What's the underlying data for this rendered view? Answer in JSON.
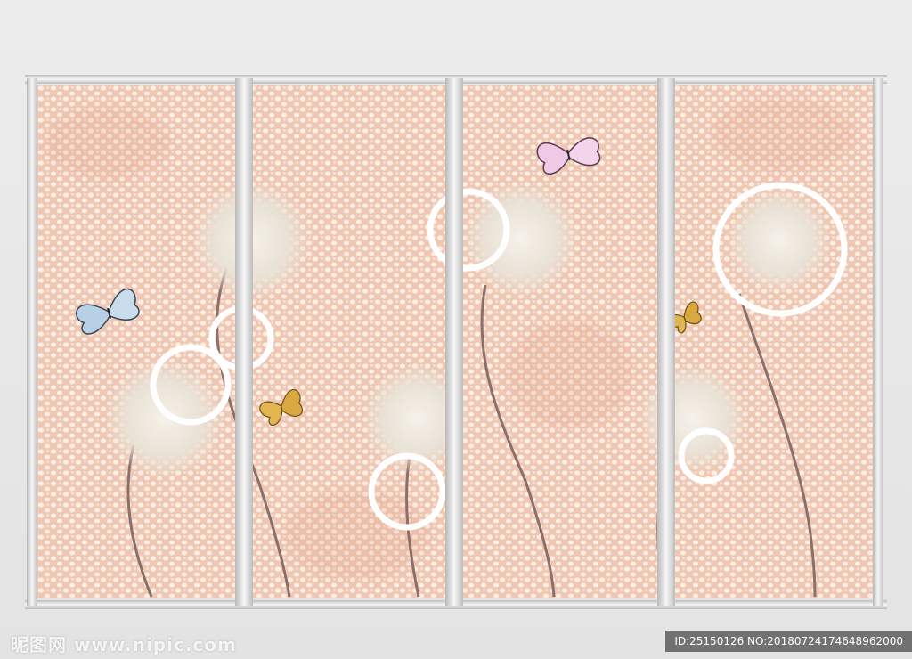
{
  "watermarks": {
    "site": "昵图网 www.nipic.com",
    "image_id": "ID:25150126 NO:20180724174648962000"
  },
  "colors": {
    "wall": "#e6e6e6",
    "panel_base": "#f0c9b6",
    "panel_dots": "#fbeee4",
    "frame": "#c8c8c8",
    "ring": "#ffffff",
    "stem": "#8a6f6a"
  },
  "panels": [
    {
      "name": "panel-1",
      "motifs": [
        "dandelion-icon",
        "dandelion-icon",
        "ring-icon",
        "ring-icon",
        "butterfly-icon"
      ]
    },
    {
      "name": "panel-2",
      "motifs": [
        "dandelion-icon",
        "ring-icon",
        "butterfly-icon"
      ]
    },
    {
      "name": "panel-3",
      "motifs": [
        "dandelion-icon",
        "ring-icon",
        "butterfly-icon"
      ]
    },
    {
      "name": "panel-4",
      "motifs": [
        "dandelion-icon",
        "dandelion-icon",
        "ring-icon",
        "ring-icon",
        "butterfly-icon"
      ]
    }
  ]
}
